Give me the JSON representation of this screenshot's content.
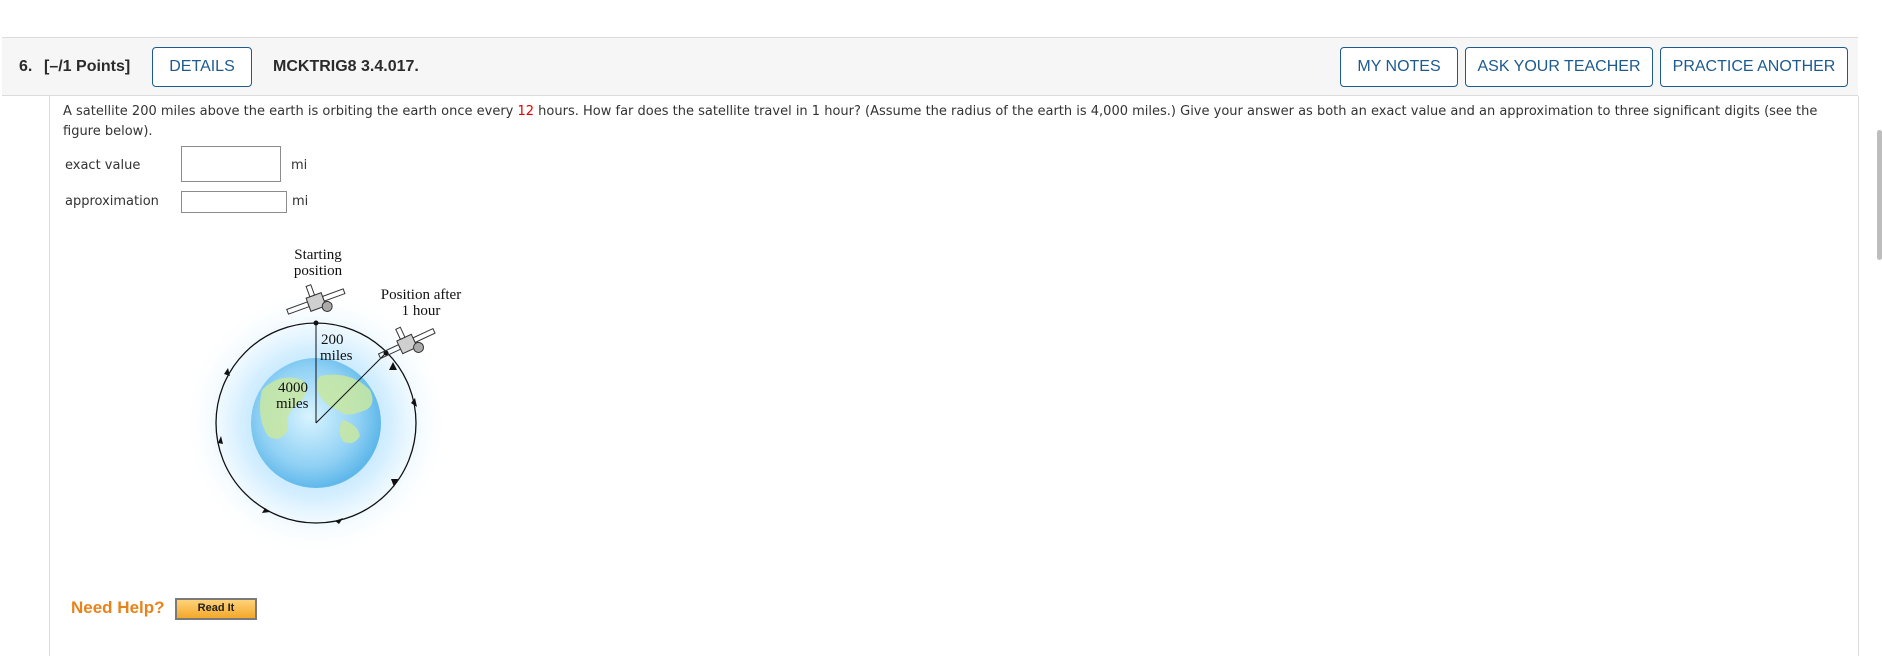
{
  "header": {
    "question_number": "6.",
    "points": "[–/1 Points]",
    "details_label": "DETAILS",
    "code": "MCKTRIG8 3.4.017.",
    "my_notes_label": "MY NOTES",
    "ask_teacher_label": "ASK YOUR TEACHER",
    "practice_label": "PRACTICE ANOTHER"
  },
  "question": {
    "text_before": "A satellite 200 miles above the earth is orbiting the earth once every ",
    "highlight": "12",
    "text_after": " hours. How far does the satellite travel in 1 hour? (Assume the radius of the earth is 4,000 miles.) Give your answer as both an exact value and an approximation to three significant digits (see the figure below)."
  },
  "answers": [
    {
      "label": "exact value",
      "value": "",
      "unit": "mi"
    },
    {
      "label": "approximation",
      "value": "",
      "unit": "mi"
    }
  ],
  "figure": {
    "start_label_1": "Starting",
    "start_label_2": "position",
    "after_label_1": "Position after",
    "after_label_2": "1 hour",
    "alt_label_1": "200",
    "alt_label_2": "miles",
    "radius_label_1": "4000",
    "radius_label_2": "miles"
  },
  "help": {
    "label": "Need Help?",
    "read_it_label": "Read It"
  },
  "colors": {
    "accent": "#1d5a8e",
    "help": "#e8831b",
    "highlight": "#e00000"
  }
}
